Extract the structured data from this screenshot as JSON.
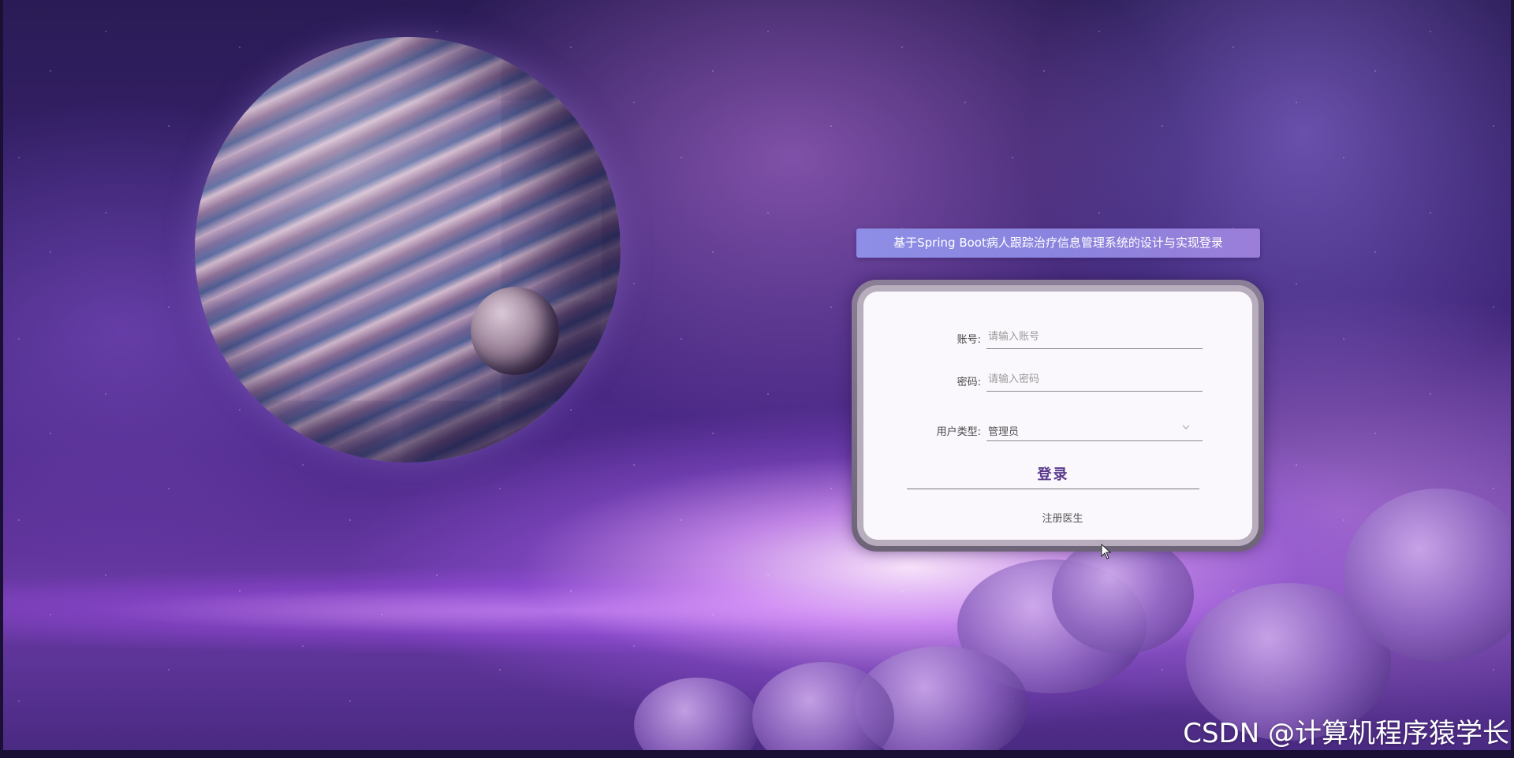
{
  "login": {
    "title": "基于Spring Boot病人跟踪治疗信息管理系统的设计与实现登录",
    "account_label": "账号:",
    "account_placeholder": "请输入账号",
    "password_label": "密码:",
    "password_placeholder": "请输入密码",
    "user_type_label": "用户类型:",
    "user_type_selected": "管理员",
    "login_button": "登录",
    "register_link": "注册医生"
  },
  "watermark": "CSDN @计算机程序猿学长",
  "icons": {
    "select_arrow": "chevron-down-icon",
    "pointer": "mouse-cursor-icon"
  },
  "colors": {
    "title_bar": "#8a84df",
    "login_button_text": "#5b3a8c",
    "card_background": "#fbf8fd"
  }
}
